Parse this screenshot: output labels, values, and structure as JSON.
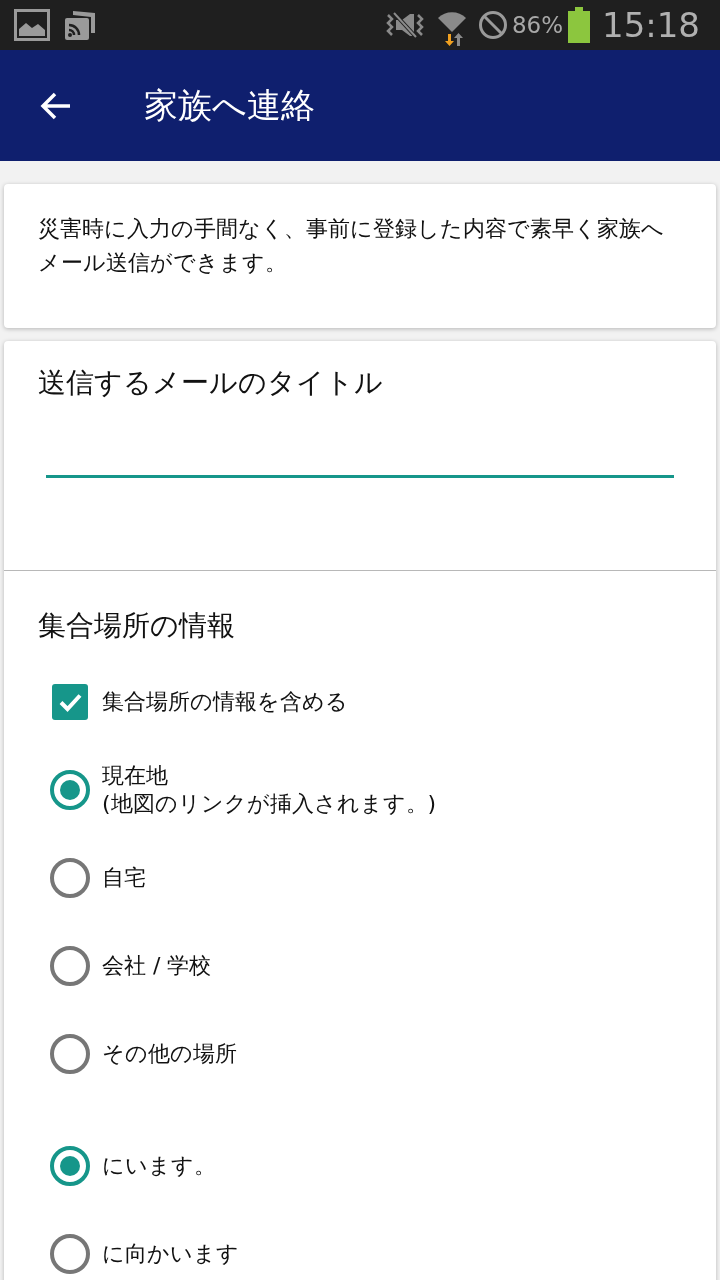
{
  "status_bar": {
    "battery_text": "86%",
    "time": "15:18"
  },
  "app_bar": {
    "title": "家族へ連絡"
  },
  "intro_card": {
    "text": "災害時に入力の手間なく、事前に登録した内容で素早く家族へメール送信ができます。"
  },
  "mail_title": {
    "label": "送信するメールのタイトル"
  },
  "meeting_place": {
    "heading": "集合場所の情報",
    "include_checkbox": {
      "label": "集合場所の情報を含める",
      "checked": true
    },
    "place_options": [
      {
        "label": "現在地",
        "note": "(地図のリンクが挿入されます。)",
        "selected": true
      },
      {
        "label": "自宅",
        "selected": false
      },
      {
        "label": "会社 / 学校",
        "selected": false
      },
      {
        "label": "その他の場所",
        "selected": false
      }
    ],
    "status_options": [
      {
        "label": "にいます。",
        "selected": true
      },
      {
        "label": "に向かいます",
        "selected": false
      }
    ]
  }
}
